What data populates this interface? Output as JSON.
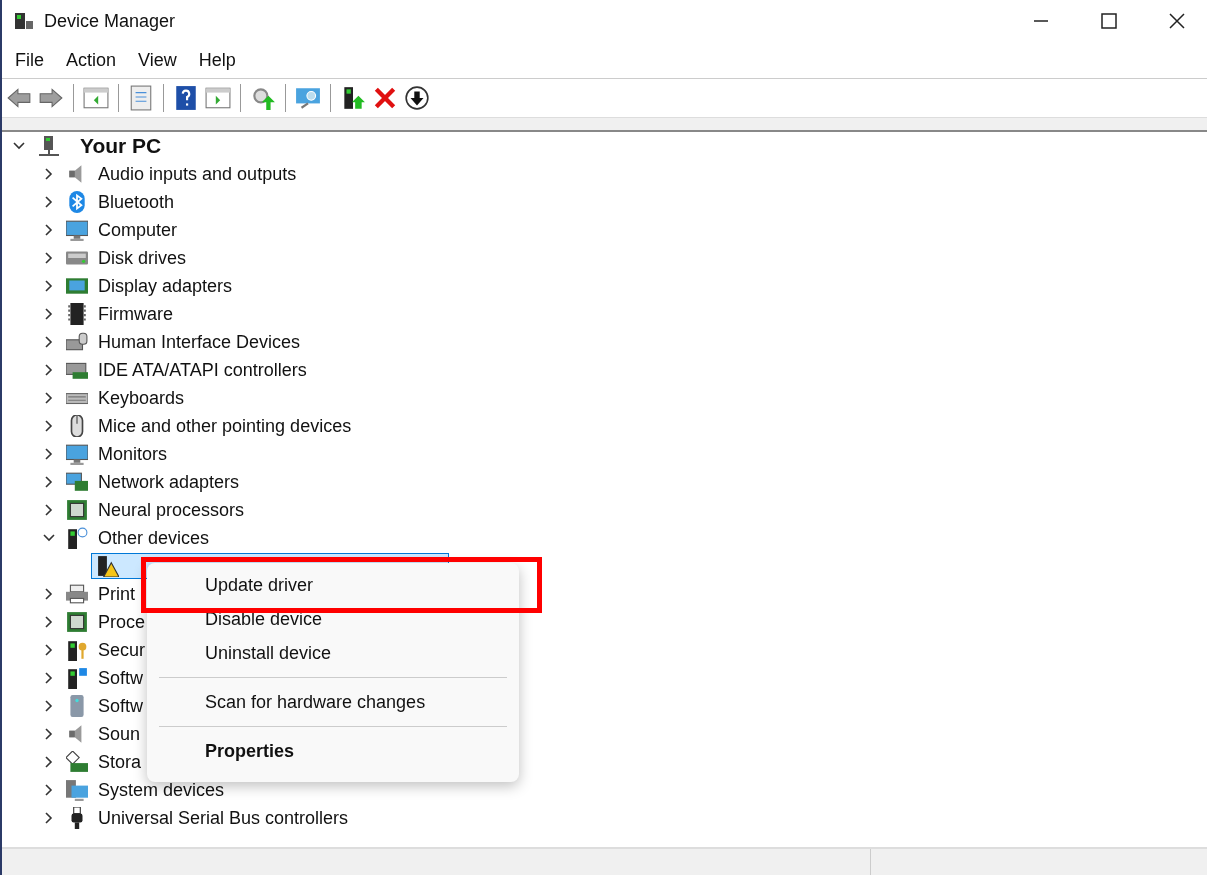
{
  "window": {
    "title": "Device Manager"
  },
  "menu_bar": [
    "File",
    "Action",
    "View",
    "Help"
  ],
  "toolbar": [
    {
      "kind": "back"
    },
    {
      "kind": "forward"
    },
    {
      "kind": "separator"
    },
    {
      "kind": "pane"
    },
    {
      "kind": "separator"
    },
    {
      "kind": "properties"
    },
    {
      "kind": "separator"
    },
    {
      "kind": "help"
    },
    {
      "kind": "pane2"
    },
    {
      "kind": "separator"
    },
    {
      "kind": "gear"
    },
    {
      "kind": "separator"
    },
    {
      "kind": "scan"
    },
    {
      "kind": "separator"
    },
    {
      "kind": "update"
    },
    {
      "kind": "delete"
    },
    {
      "kind": "download"
    }
  ],
  "tree": {
    "label": "Your PC",
    "expanded": true,
    "selected": false,
    "children": [
      {
        "label": "Audio inputs and outputs",
        "kind": "speaker",
        "expanded": false,
        "selected": false
      },
      {
        "label": "Bluetooth",
        "kind": "bluetooth",
        "expanded": false,
        "selected": false
      },
      {
        "label": "Computer",
        "kind": "monitor",
        "expanded": false,
        "selected": false
      },
      {
        "label": "Disk drives",
        "kind": "disk",
        "expanded": false,
        "selected": false
      },
      {
        "label": "Display adapters",
        "kind": "display",
        "expanded": false,
        "selected": false
      },
      {
        "label": "Firmware",
        "kind": "firmware",
        "expanded": false,
        "selected": false
      },
      {
        "label": "Human Interface Devices",
        "kind": "hid",
        "expanded": false,
        "selected": false
      },
      {
        "label": "IDE ATA/ATAPI controllers",
        "kind": "board",
        "expanded": false,
        "selected": false
      },
      {
        "label": "Keyboards",
        "kind": "keyboard",
        "expanded": false,
        "selected": false
      },
      {
        "label": "Mice and other pointing devices",
        "kind": "mouse",
        "expanded": false,
        "selected": false
      },
      {
        "label": "Monitors",
        "kind": "monitor",
        "expanded": false,
        "selected": false
      },
      {
        "label": "Network adapters",
        "kind": "network",
        "expanded": false,
        "selected": false
      },
      {
        "label": "Neural processors",
        "kind": "chip",
        "expanded": false,
        "selected": false
      },
      {
        "label": "Other devices",
        "kind": "other",
        "expanded": true,
        "selected": false,
        "children": [
          {
            "kind": "warning",
            "selected": true
          }
        ]
      },
      {
        "label": "Print",
        "kind": "printer",
        "expanded": false,
        "selected": false
      },
      {
        "label": "Proce",
        "kind": "chip",
        "expanded": false,
        "selected": false
      },
      {
        "label": "Secur",
        "kind": "security",
        "expanded": false,
        "selected": false
      },
      {
        "label": "Softw",
        "kind": "software",
        "expanded": false,
        "selected": false
      },
      {
        "label": "Softw",
        "kind": "tower",
        "expanded": false,
        "selected": false
      },
      {
        "label": "Soun",
        "kind": "speaker",
        "expanded": false,
        "selected": false
      },
      {
        "label": "Stora",
        "kind": "storage",
        "expanded": false,
        "selected": false
      },
      {
        "label": "System devices",
        "kind": "system",
        "expanded": false,
        "selected": false
      },
      {
        "label": "Universal Serial Bus controllers",
        "kind": "usb",
        "expanded": false,
        "selected": false
      }
    ]
  },
  "context_menu": {
    "groups": [
      [
        {
          "label": "Update driver",
          "default": false,
          "highlighted": true
        },
        {
          "label": "Disable device",
          "default": false,
          "highlighted": false
        },
        {
          "label": "Uninstall device",
          "default": false,
          "highlighted": false
        }
      ],
      [
        {
          "label": "Scan for hardware changes",
          "default": false,
          "highlighted": false
        }
      ],
      [
        {
          "label": "Properties",
          "default": true,
          "highlighted": false
        }
      ]
    ]
  }
}
